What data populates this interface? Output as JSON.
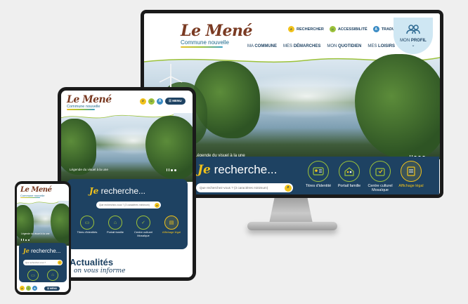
{
  "brand": {
    "name": "Le Mené",
    "tagline": "Commune nouvelle",
    "colors": {
      "navy": "#1e4262",
      "yellow": "#f1c21b",
      "green": "#9cc23a",
      "blue": "#3a8bc4",
      "brown": "#7a3a22"
    }
  },
  "desktop": {
    "utilities": [
      {
        "label": "RECHERCHER",
        "icon": "search-icon"
      },
      {
        "label": "ACCESSIBILITÉ",
        "icon": "accessibility-icon"
      },
      {
        "label": "TRADUCTION",
        "icon": "translate-icon"
      }
    ],
    "menu": [
      {
        "pre": "MA ",
        "strong": "COMMUNE"
      },
      {
        "pre": "MES ",
        "strong": "DÉMARCHES"
      },
      {
        "pre": "MON ",
        "strong": "QUOTIDIEN"
      },
      {
        "pre": "MES ",
        "strong": "LOISIRS"
      }
    ],
    "profile": {
      "pre": "MON ",
      "strong": "PROFIL",
      "icon": "users-icon"
    },
    "caption": "Légende du visuel à la une",
    "search": {
      "je": "Je",
      "title": "recherche...",
      "placeholder": "Que recherchez-vous ? (3 caractères minimum)"
    },
    "quick_links": [
      {
        "label": "Titres d'identité",
        "icon": "id-card-icon"
      },
      {
        "label": "Portail famille",
        "icon": "family-home-icon"
      },
      {
        "label": "Centre culturel Mosaïque",
        "icon": "culture-center-icon"
      },
      {
        "label": "Affichage légal",
        "icon": "legal-notice-icon"
      }
    ]
  },
  "tablet": {
    "menu_label": "MENU",
    "caption": "Légende du visuel à la une",
    "search": {
      "je": "Je",
      "title": "recherche...",
      "placeholder": "Que recherchez-vous ? (3 caractères minimum)"
    },
    "quick_links": [
      {
        "label": "Titres d'identités"
      },
      {
        "label": "Portail famille"
      },
      {
        "label": "Centre culturel Mosaïque"
      },
      {
        "label": "Affichage légal"
      }
    ],
    "news_title": "Actualités",
    "news_subtitle": "on vous informe"
  },
  "phone": {
    "caption": "Légende du visuel à la une",
    "search": {
      "je": "Je",
      "title": "recherche...",
      "placeholder": "Que recherchez-vous ?"
    },
    "menu_label": "MENU"
  }
}
